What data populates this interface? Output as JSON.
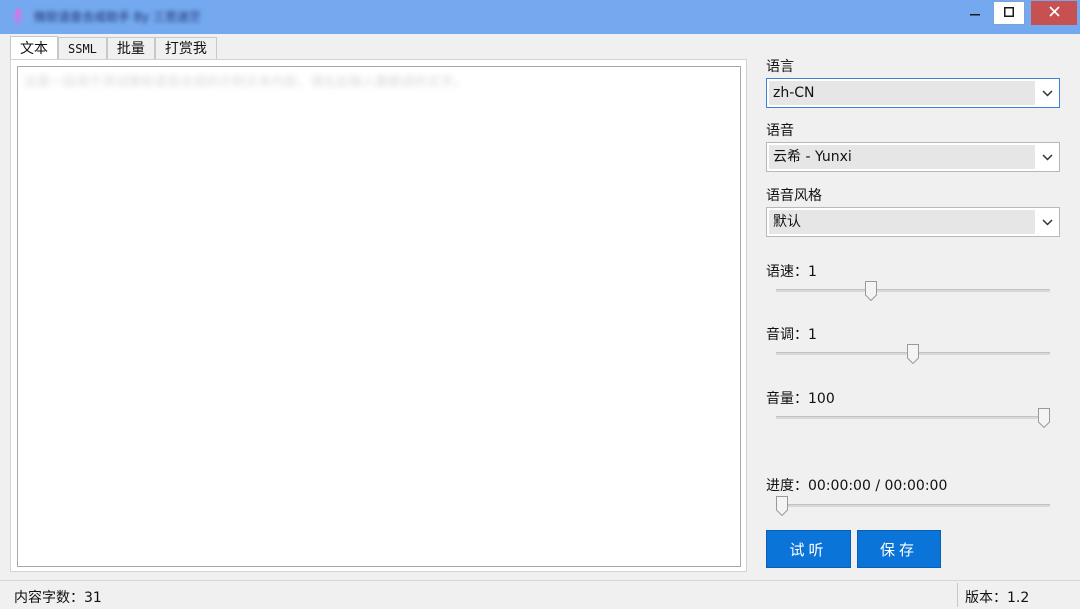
{
  "window": {
    "title": "微软语音合成助手 By 三思迷茫",
    "controls": {
      "minimize": "—",
      "maximize": "□",
      "close": "✕"
    }
  },
  "tabs": [
    {
      "label": "文本",
      "active": true
    },
    {
      "label": "SSML",
      "active": false
    },
    {
      "label": "批量",
      "active": false
    },
    {
      "label": "打赏我",
      "active": false
    }
  ],
  "editor": {
    "content": "这是一段用于测试微软语音合成的示例文本内容，请在此输入要朗读的文字。"
  },
  "settings": {
    "language": {
      "label": "语言",
      "value": "zh-CN"
    },
    "voice": {
      "label": "语音",
      "value": "云希 - Yunxi"
    },
    "style": {
      "label": "语音风格",
      "value": "默认"
    },
    "rate": {
      "label": "语速：1",
      "level": 0.34
    },
    "pitch": {
      "label": "音调：1",
      "level": 0.5
    },
    "volume": {
      "label": "音量：100",
      "level": 1.0
    },
    "progress": {
      "label": "进度：00:00:00 / 00:00:00",
      "level": 0.0
    }
  },
  "buttons": {
    "preview": "试听",
    "save": "保存"
  },
  "status": {
    "char_count": "内容字数：31",
    "version": "版本：1.2"
  },
  "colors": {
    "titlebar": "#74a9f0",
    "accent": "#0a74d8",
    "close": "#c75050"
  },
  "icons": {
    "app": "microphone-icon",
    "chevron": "chevron-down-icon"
  }
}
